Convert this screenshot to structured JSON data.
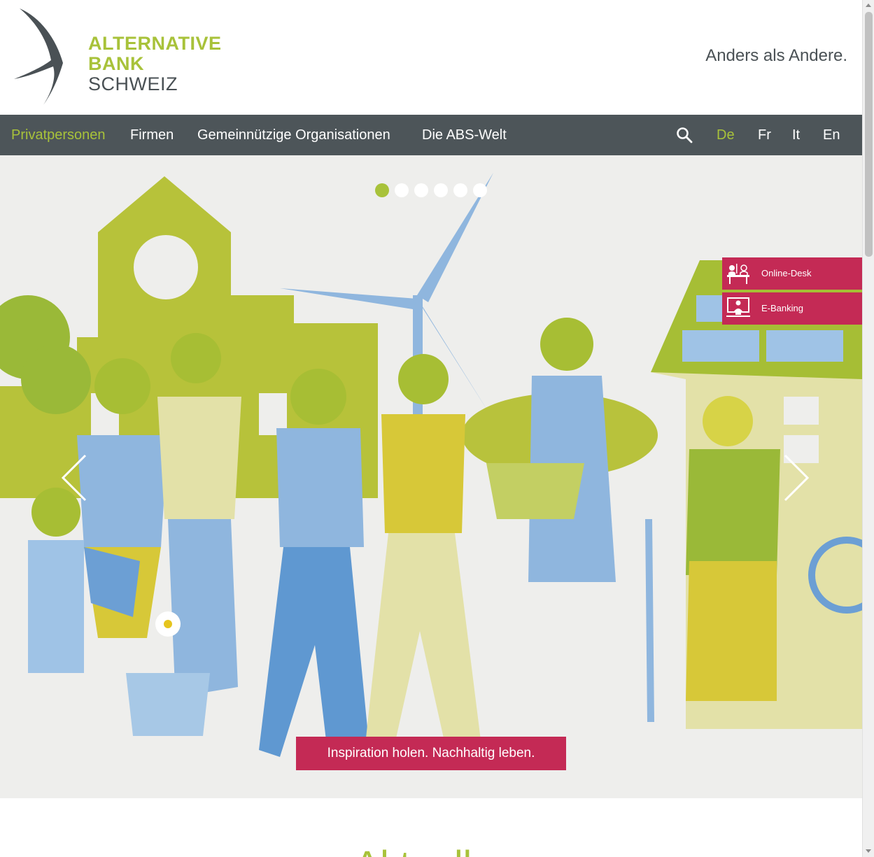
{
  "brand": {
    "line1": "ALTERNATIVE",
    "line2": "BANK",
    "line3": "SCHWEIZ",
    "tagline": "Anders als Andere.",
    "green": "#a8c23a",
    "grey": "#4a5155",
    "accent": "#c42a55"
  },
  "nav": {
    "items": [
      {
        "label": "Privatpersonen",
        "active": true
      },
      {
        "label": "Firmen",
        "active": false
      },
      {
        "label": "Gemeinnützige Organisationen",
        "active": false
      },
      {
        "label": "Die ABS-Welt",
        "active": false
      }
    ],
    "search_icon": "search-icon",
    "languages": [
      {
        "label": "De",
        "active": true
      },
      {
        "label": "Fr",
        "active": false
      },
      {
        "label": "It",
        "active": false
      },
      {
        "label": "En",
        "active": false
      }
    ]
  },
  "hero": {
    "slides_total": 6,
    "active_slide": 1,
    "cta_label": "Inspiration holen. Nachhaltig leben.",
    "prev_icon": "chevron-left-icon",
    "next_icon": "chevron-right-icon"
  },
  "side_links": [
    {
      "label": "Online-Desk",
      "icon": "consultation-icon"
    },
    {
      "label": "E-Banking",
      "icon": "computer-user-icon"
    }
  ],
  "section": {
    "title": "Aktuell"
  }
}
